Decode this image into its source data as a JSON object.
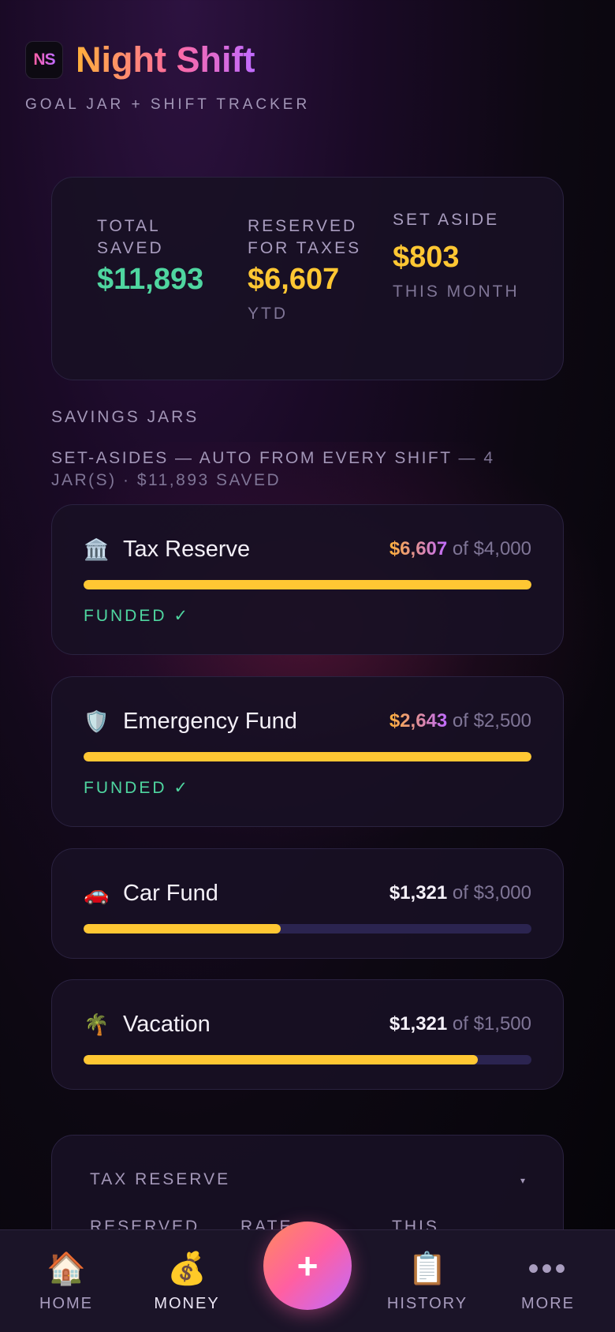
{
  "app": {
    "logo": "NS",
    "title": "Night Shift",
    "subtitle": "GOAL JAR + SHIFT TRACKER"
  },
  "summary": {
    "total_saved": {
      "label": "TOTAL SAVED",
      "value": "$11,893"
    },
    "reserved_taxes": {
      "label": "RESERVED FOR TAXES",
      "value": "$6,607",
      "sub": "YTD"
    },
    "set_aside": {
      "label": "SET ASIDE",
      "value": "$803",
      "sub": "THIS MONTH"
    }
  },
  "jars_section": {
    "title": "SAVINGS JARS",
    "subtitle_main": "SET-ASIDES — AUTO FROM EVERY SHIFT",
    "subtitle_rest": " — 4 JAR(S) · $11,893 SAVED"
  },
  "jars": [
    {
      "icon": "bank-icon",
      "emoji": "🏛️",
      "name": "Tax Reserve",
      "current": "$6,607",
      "of_text": " of $4,000",
      "progress": 1.0,
      "funded": "FUNDED ✓"
    },
    {
      "icon": "shield-icon",
      "emoji": "🛡️",
      "name": "Emergency Fund",
      "current": "$2,643",
      "of_text": " of $2,500",
      "progress": 1.0,
      "funded": "FUNDED ✓"
    },
    {
      "icon": "car-icon",
      "emoji": "🚗",
      "name": "Car Fund",
      "current": "$1,321",
      "of_text": " of $3,000",
      "progress": 0.44
    },
    {
      "icon": "palm-tree-icon",
      "emoji": "🌴",
      "name": "Vacation",
      "current": "$1,321",
      "of_text": " of $1,500",
      "progress": 0.88
    }
  ],
  "tax_card": {
    "title": "TAX RESERVE",
    "caret": "▾",
    "col1": "RESERVED",
    "col2": "RATE",
    "col3": "THIS"
  },
  "nav": {
    "home": "HOME",
    "money": "MONEY",
    "add": "+",
    "history": "HISTORY",
    "more": "MORE",
    "more_dots": "•••"
  },
  "colors": {
    "accent_yellow": "#ffc733",
    "accent_green": "#4fd6a0",
    "accent_pink": "#ff5fa2",
    "accent_purple": "#c06bff"
  }
}
